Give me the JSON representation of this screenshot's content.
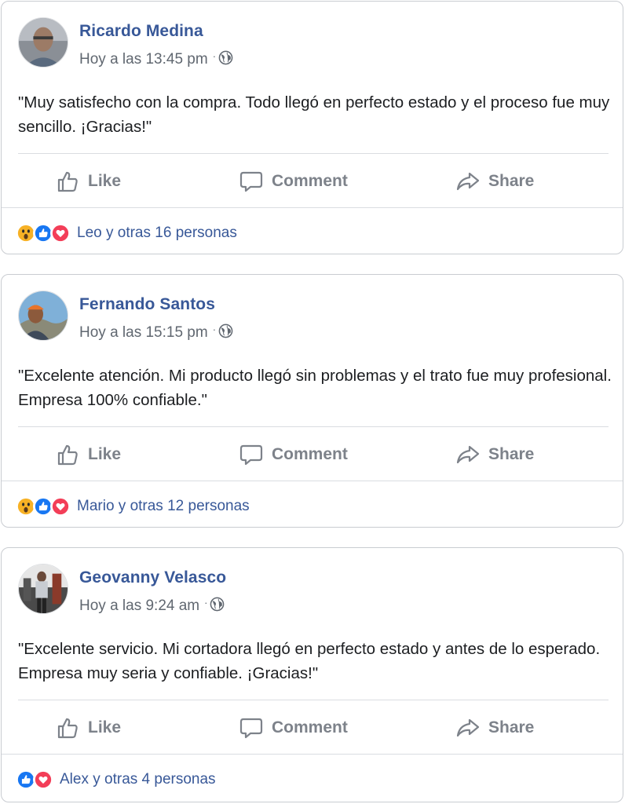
{
  "posts": [
    {
      "author": "Ricardo Medina",
      "time": "Hoy a las 13:45 pm",
      "text": "\"Muy satisfecho con la compra. Todo llegó en perfecto estado y el proceso fue muy sencillo. ¡Gracias!\"",
      "actions": {
        "like": "Like",
        "comment": "Comment",
        "share": "Share"
      },
      "reactions": [
        "wow",
        "like",
        "love"
      ],
      "reaction_text": "Leo y otras 16 personas"
    },
    {
      "author": "Fernando Santos",
      "time": "Hoy a las 15:15 pm",
      "text": "\"Excelente atención. Mi producto llegó sin problemas y el trato fue muy profesional. Empresa 100% confiable.\"",
      "actions": {
        "like": "Like",
        "comment": "Comment",
        "share": "Share"
      },
      "reactions": [
        "wow",
        "like",
        "love"
      ],
      "reaction_text": "Mario y otras 12 personas"
    },
    {
      "author": "Geovanny Velasco",
      "time": "Hoy a las 9:24 am",
      "text": "\"Excelente servicio. Mi cortadora llegó en perfecto estado y antes de lo esperado. Empresa muy seria y confiable. ¡Gracias!\"",
      "actions": {
        "like": "Like",
        "comment": "Comment",
        "share": "Share"
      },
      "reactions": [
        "like",
        "love"
      ],
      "reaction_text": "Alex y otras 4 personas"
    }
  ],
  "icons": {
    "like": "thumbs-up-outline-icon",
    "comment": "speech-bubble-icon",
    "share": "share-arrow-icon",
    "privacy": "globe-icon"
  },
  "colors": {
    "name": "#385898",
    "like_reaction": "#1877f2",
    "love_reaction": "#f33e58",
    "wow_reaction": "#f7b125",
    "action_text": "#7d828a"
  }
}
